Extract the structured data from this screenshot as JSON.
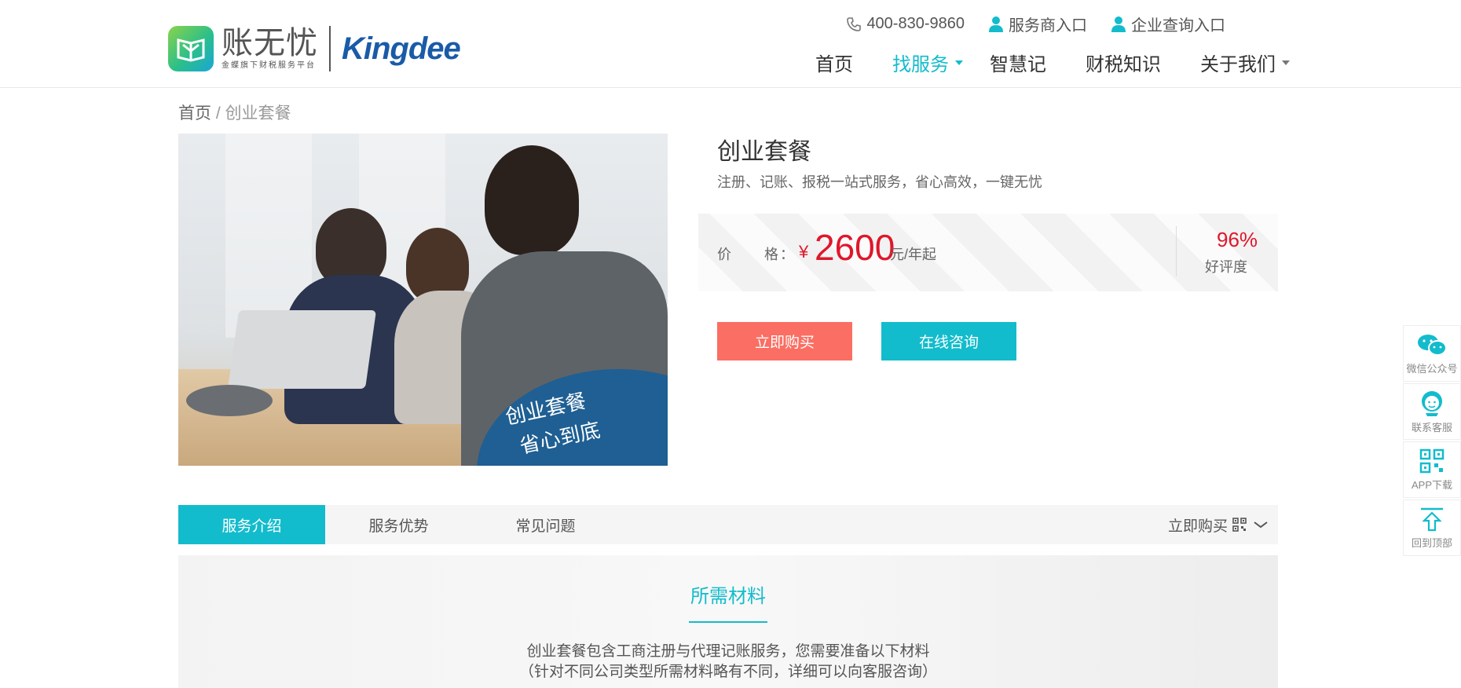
{
  "header": {
    "logo_cn": "账无忧",
    "logo_sub": "金蝶旗下财税服务平台",
    "logo_brand": "Kingdee",
    "phone": "400-830-9860",
    "provider_link": "服务商入口",
    "enterprise_link": "企业查询入口",
    "nav": [
      {
        "label": "首页"
      },
      {
        "label": "找服务"
      },
      {
        "label": "智慧记"
      },
      {
        "label": "财税知识"
      },
      {
        "label": "关于我们"
      }
    ]
  },
  "breadcrumb": {
    "home": "首页",
    "sep": "/",
    "current": "创业套餐"
  },
  "product": {
    "image_text_line1": "创业套餐",
    "image_text_line2": "省心到底",
    "title": "创业套餐",
    "subtitle": "注册、记账、报税一站式服务，省心高效，一键无忧",
    "price_label": "价　　格：",
    "price_symbol": "¥",
    "price_value": "2600",
    "price_unit": "元/年起",
    "rating_value": "96%",
    "rating_label": "好评度",
    "buy_button": "立即购买",
    "consult_button": "在线咨询"
  },
  "tabs": {
    "items": [
      {
        "label": "服务介绍"
      },
      {
        "label": "服务优势"
      },
      {
        "label": "常见问题"
      }
    ],
    "buy_label": "立即购买"
  },
  "content": {
    "title": "所需材料",
    "desc_line1": "创业套餐包含工商注册与代理记账服务，您需要准备以下材料",
    "desc_line2": "（针对不同公司类型所需材料略有不同，详细可以向客服咨询）"
  },
  "float_bar": {
    "wechat": "微信公众号",
    "service": "联系客服",
    "app": "APP下载",
    "top": "回到顶部"
  },
  "colors": {
    "accent": "#12bccc",
    "price": "#e0162b",
    "buy_button": "#fb6e63",
    "brand_blue": "#1a5ba8"
  }
}
